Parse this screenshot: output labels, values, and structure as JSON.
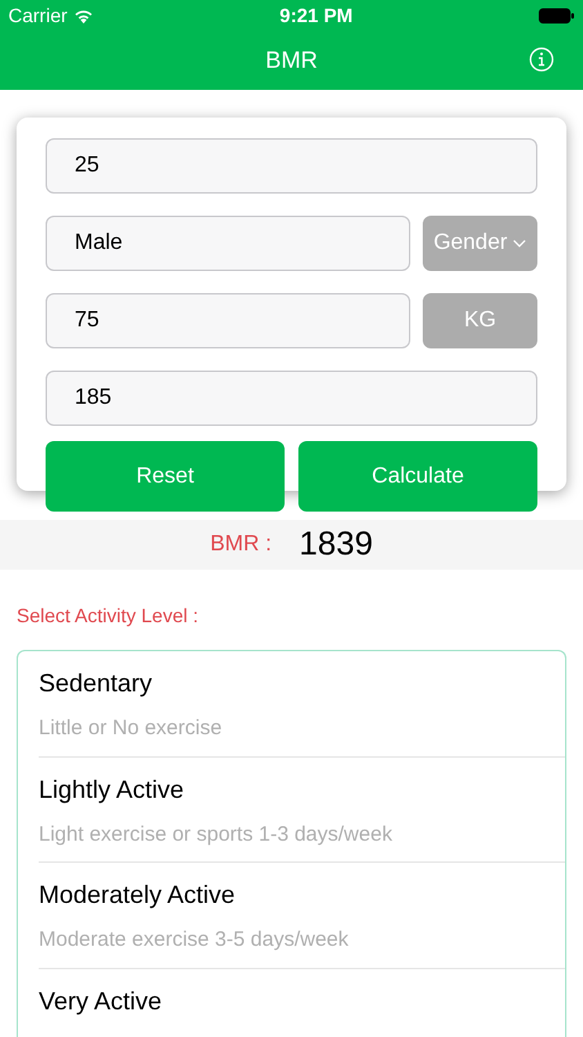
{
  "status_bar": {
    "carrier": "Carrier",
    "time": "9:21 PM"
  },
  "nav_bar": {
    "title": "BMR"
  },
  "form": {
    "age": {
      "value": "25"
    },
    "gender": {
      "value": "Male",
      "button": "Gender"
    },
    "weight": {
      "value": "75",
      "unit": "KG"
    },
    "height": {
      "value": "185"
    },
    "buttons": [
      "Reset",
      "Calculate"
    ]
  },
  "result": {
    "label": "BMR :",
    "value": "1839"
  },
  "activity": {
    "heading": "Select Activity Level :",
    "levels": [
      {
        "title": "Sedentary",
        "subtitle": "Little or No exercise"
      },
      {
        "title": "Lightly Active",
        "subtitle": "Light exercise or sports 1-3 days/week"
      },
      {
        "title": "Moderately Active",
        "subtitle": "Moderate exercise 3-5 days/week"
      },
      {
        "title": "Very Active"
      }
    ]
  }
}
